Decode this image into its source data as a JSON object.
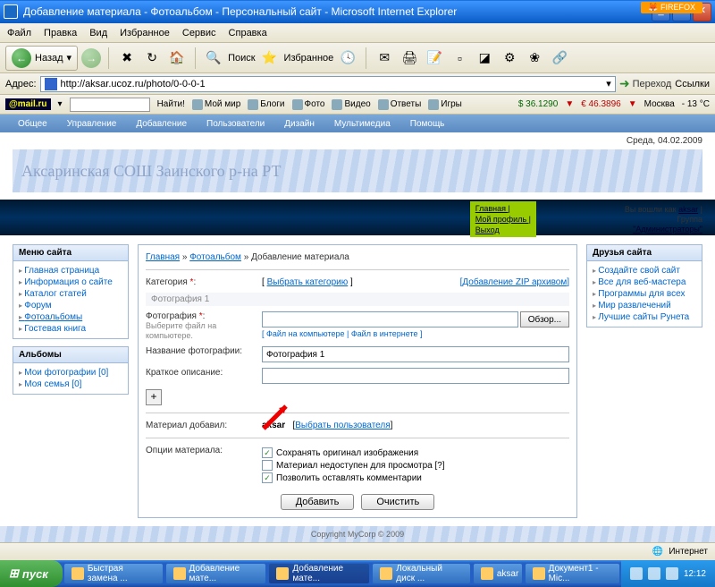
{
  "window": {
    "title": "Добавление материала - Фотоальбом - Персональный сайт - Microsoft Internet Explorer"
  },
  "menubar": {
    "items": [
      "Файл",
      "Правка",
      "Вид",
      "Избранное",
      "Сервис",
      "Справка"
    ]
  },
  "toolbar": {
    "back": "Назад",
    "search": "Поиск",
    "favorites": "Избранное"
  },
  "address": {
    "label": "Адрес:",
    "url": "http://aksar.ucoz.ru/photo/0-0-0-1",
    "go": "Переход",
    "links": "Ссылки"
  },
  "mailru": {
    "logo": "@mail.ru",
    "find": "Найти!",
    "items": [
      "Мой мир",
      "Блоги",
      "Фото",
      "Видео",
      "Ответы",
      "Игры"
    ],
    "rate1": "$ 36.1290",
    "rate2": "€ 46.3896",
    "city": "Москва",
    "temp": "- 13 °C"
  },
  "site_tabs": [
    "Общее",
    "Управление",
    "Добавление",
    "Пользователи",
    "Дизайн",
    "Мультимедиа",
    "Помощь"
  ],
  "date": "Среда, 04.02.2009",
  "banner": "Аксаринская СОШ Заинского р-на РТ",
  "greenbox": [
    "Главная |",
    "Мой профиль |",
    "Выход"
  ],
  "login": {
    "line1": "Вы вошли как",
    "user": "aksar",
    "line2": "Группа",
    "group": "\"Администраторы\""
  },
  "sidebar": {
    "menu_title": "Меню сайта",
    "menu_items": [
      "Главная страница",
      "Информация о сайте",
      "Каталог статей",
      "Форум",
      "Фотоальбомы",
      "Гостевая книга"
    ],
    "albums_title": "Альбомы",
    "albums_items": [
      "Мои фотографии [0]",
      "Моя семья [0]"
    ],
    "friends_title": "Друзья сайта",
    "friends_items": [
      "Создайте свой сайт",
      "Все для веб-мастера",
      "Программы для всех",
      "Мир развлечений",
      "Лучшие сайты Рунета"
    ]
  },
  "crumbs": {
    "home": "Главная",
    "photo": "Фотоальбом",
    "current": "Добавление материала"
  },
  "form": {
    "category_label": "Категория",
    "choose_category": "Выбрать категорию",
    "zip_link": "Добавление ZIP архивом",
    "photo_section": "Фотография 1",
    "photo_label": "Фотография",
    "photo_hint": "Выберите файл на компьютере.",
    "browse": "Обзор...",
    "file_links": "[ Файл на компьютере | Файл в интернете ]",
    "name_label": "Название фотографии:",
    "name_value": "Фотография 1",
    "desc_label": "Краткое описание:",
    "plus": "+",
    "added_by_label": "Материал добавил:",
    "added_by": "aksar",
    "choose_user": "Выбрать пользователя",
    "options_label": "Опции материала:",
    "opt1": "Сохранять оригинал изображения",
    "opt2": "Материал недоступен для просмотра [?]",
    "opt3": "Позволить оставлять комментарии",
    "submit": "Добавить",
    "reset": "Очистить"
  },
  "footer": "Copyright MyCorp © 2009",
  "statusbar": "Интернет",
  "taskbar": {
    "start": "пуск",
    "items": [
      "Быстрая замена ...",
      "Добавление мате...",
      "Добавление мате...",
      "Локальный диск ...",
      "aksar",
      "Документ1 - Mic..."
    ],
    "time": "12:12"
  }
}
